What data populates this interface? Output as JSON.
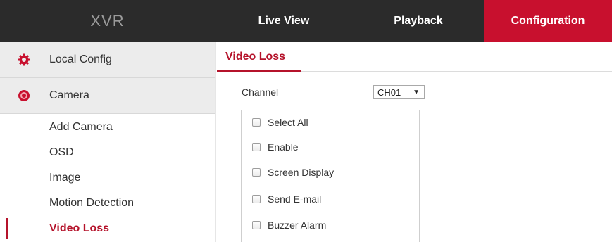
{
  "header": {
    "brand": "XVR",
    "nav": {
      "live_view": "Live View",
      "playback": "Playback",
      "configuration": "Configuration"
    }
  },
  "sidebar": {
    "local_config": "Local Config",
    "camera": "Camera",
    "items": [
      "Add Camera",
      "OSD",
      "Image",
      "Motion Detection",
      "Video Loss"
    ],
    "active_item": "Video Loss"
  },
  "main": {
    "tab": "Video Loss",
    "channel": {
      "label": "Channel",
      "selected": "CH01"
    },
    "options": {
      "select_all": "Select All",
      "enable": "Enable",
      "screen_display": "Screen Display",
      "send_email": "Send E-mail",
      "buzzer_alarm": "Buzzer Alarm"
    }
  },
  "colors": {
    "accent": "#c8102e",
    "topbar": "#2b2b2b",
    "sidebar_head": "#ececec"
  }
}
